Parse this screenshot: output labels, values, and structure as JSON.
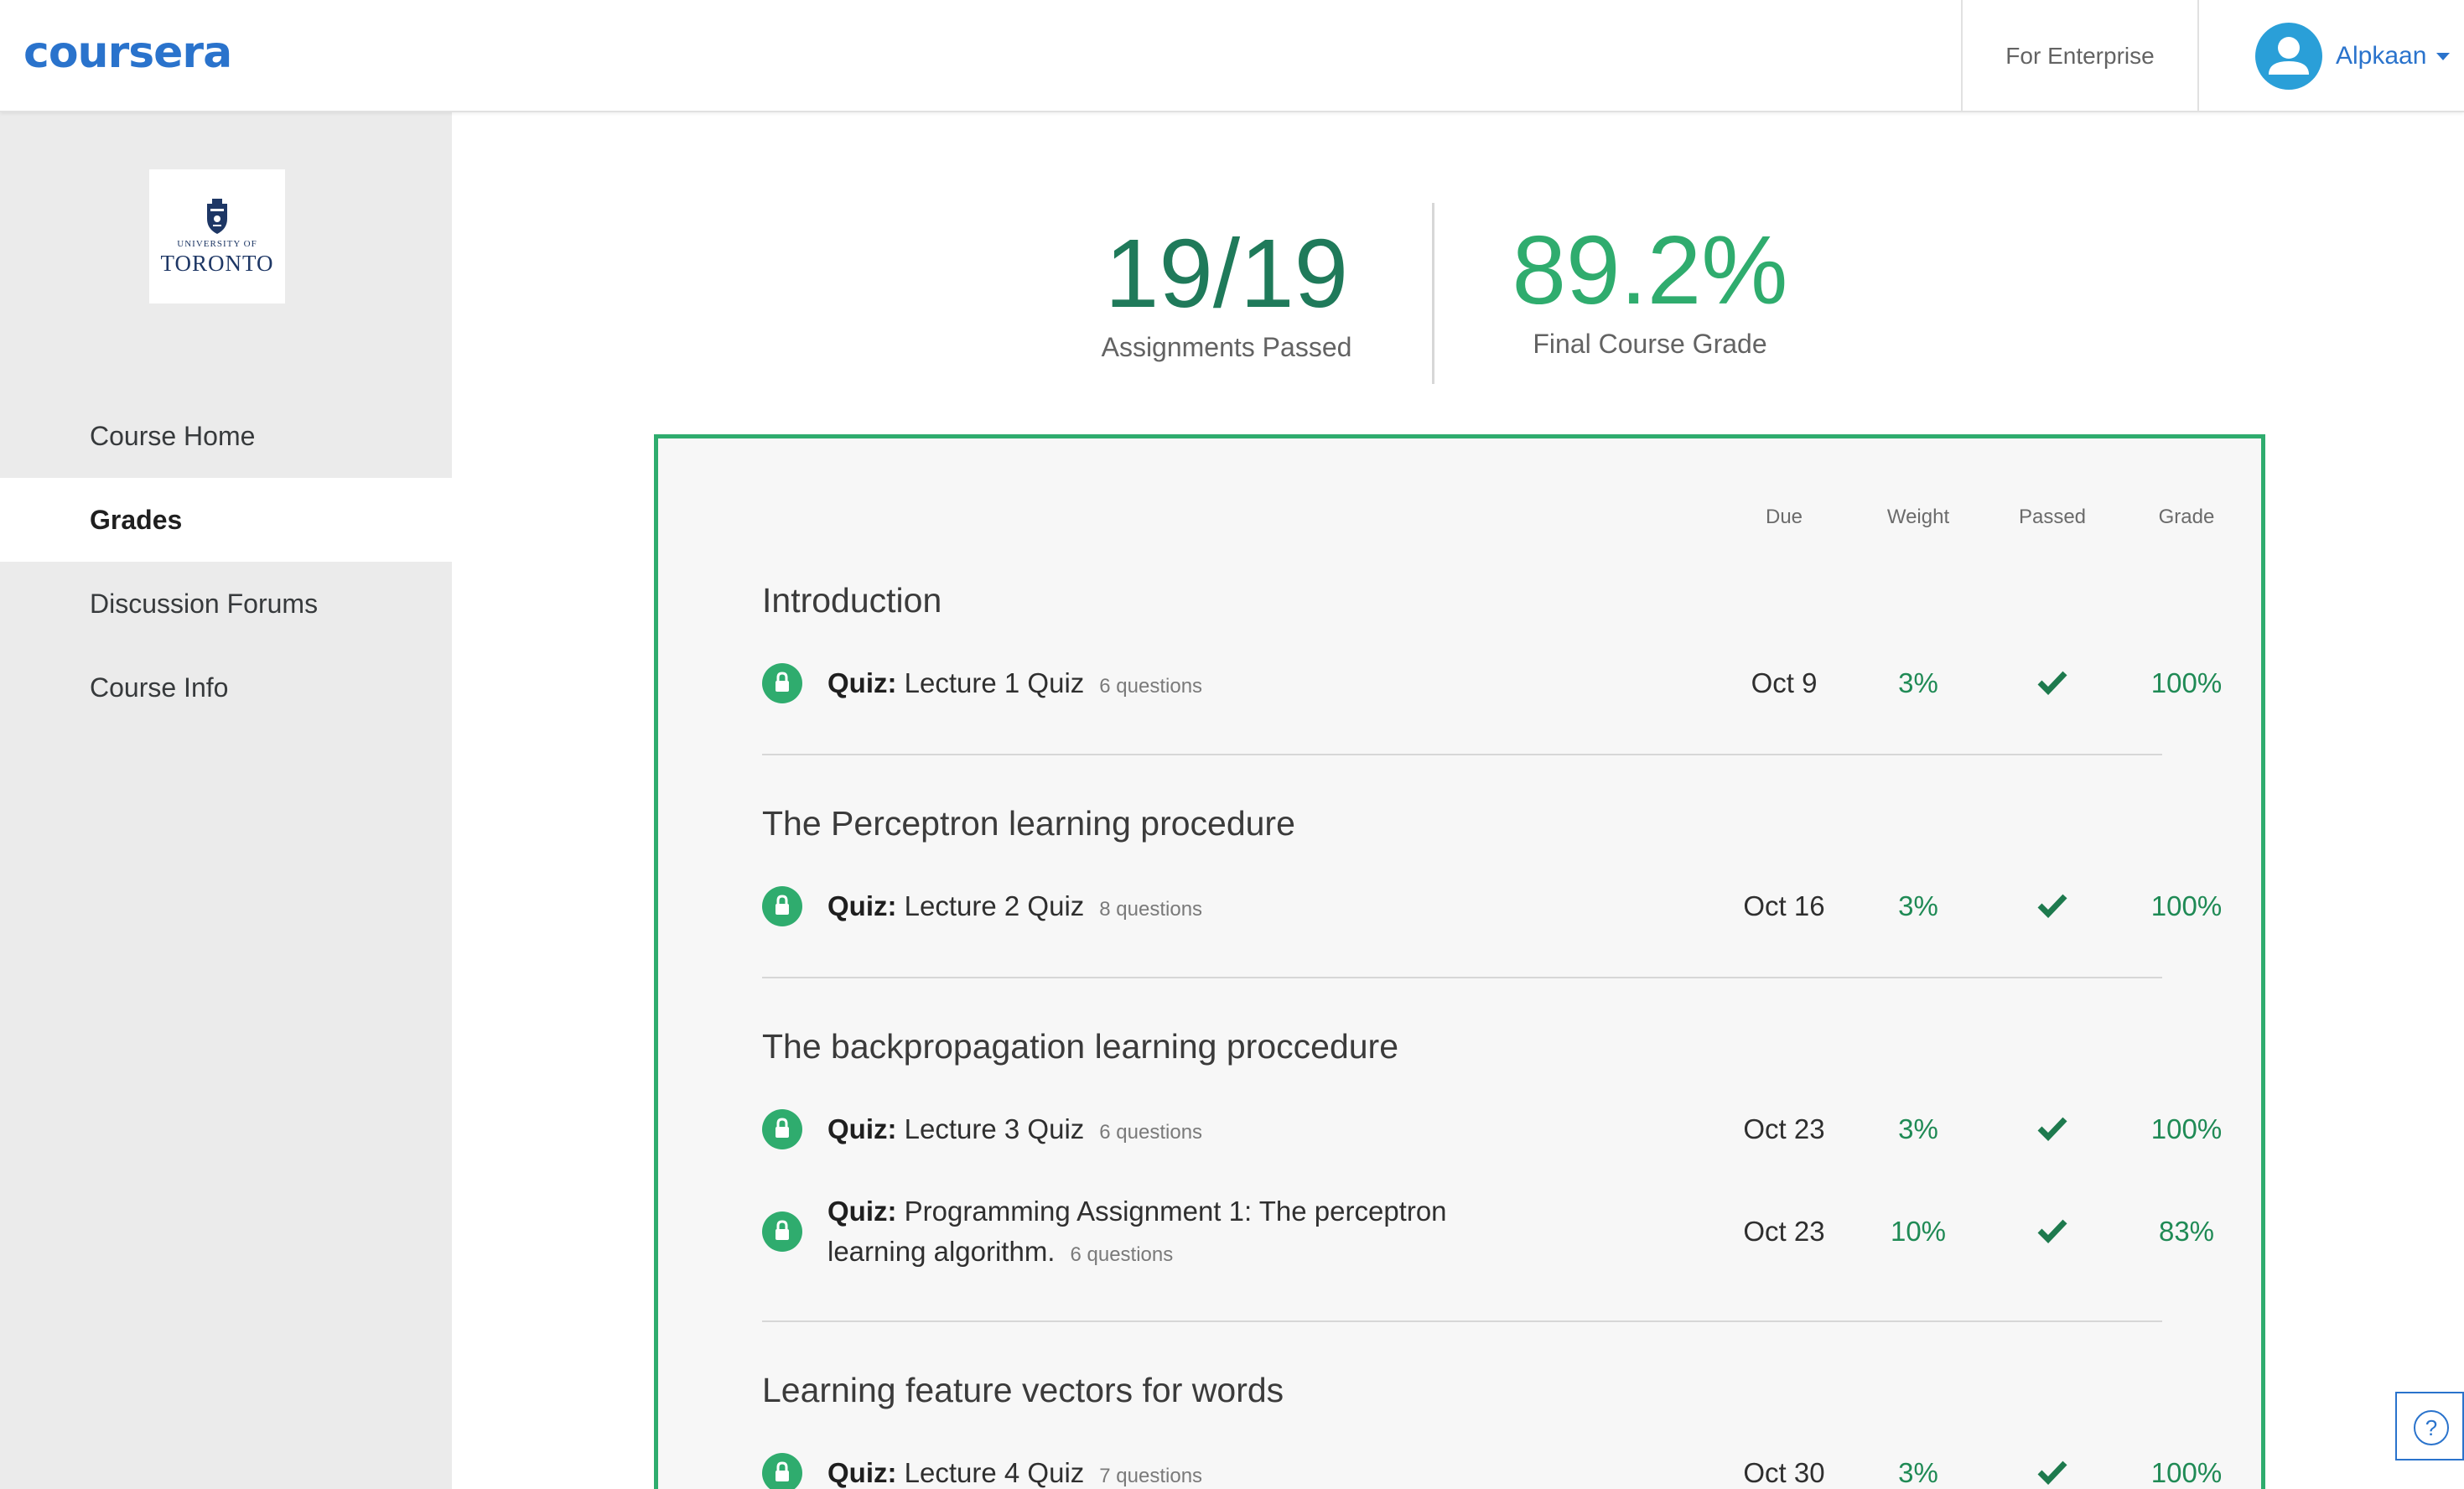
{
  "header": {
    "logo_text": "coursera",
    "enterprise_label": "For Enterprise",
    "user_name": "Alpkaan"
  },
  "sidebar": {
    "university": {
      "line1": "UNIVERSITY OF",
      "line2": "TORONTO"
    },
    "items": [
      {
        "label": "Course Home"
      },
      {
        "label": "Grades"
      },
      {
        "label": "Discussion Forums"
      },
      {
        "label": "Course Info"
      }
    ]
  },
  "summary": {
    "assignments_value": "19/19",
    "assignments_label": "Assignments Passed",
    "grade_value": "89.2%",
    "grade_label": "Final Course Grade"
  },
  "table": {
    "columns": [
      "Due",
      "Weight",
      "Passed",
      "Grade"
    ],
    "sections": [
      {
        "title": "Introduction",
        "items": [
          {
            "type": "Quiz:",
            "name": "Lecture 1 Quiz",
            "questions": "6 questions",
            "due": "Oct 9",
            "weight": "3%",
            "grade": "100%"
          }
        ]
      },
      {
        "title": "The Perceptron learning procedure",
        "items": [
          {
            "type": "Quiz:",
            "name": "Lecture 2 Quiz",
            "questions": "8 questions",
            "due": "Oct 16",
            "weight": "3%",
            "grade": "100%"
          }
        ]
      },
      {
        "title": "The backpropagation learning proccedure",
        "items": [
          {
            "type": "Quiz:",
            "name": "Lecture 3 Quiz",
            "questions": "6 questions",
            "due": "Oct 23",
            "weight": "3%",
            "grade": "100%"
          },
          {
            "type": "Quiz:",
            "name": "Programming Assignment 1: The perceptron learning algorithm.",
            "questions": "6 questions",
            "due": "Oct 23",
            "weight": "10%",
            "grade": "83%"
          }
        ]
      },
      {
        "title": "Learning feature vectors for words",
        "items": [
          {
            "type": "Quiz:",
            "name": "Lecture 4 Quiz",
            "questions": "7 questions",
            "due": "Oct 30",
            "weight": "3%",
            "grade": "100%"
          }
        ]
      }
    ]
  },
  "help_label": "?",
  "colors": {
    "brand": "#2a73cc",
    "success": "#2fac6e",
    "success_dark": "#1f8a55"
  }
}
